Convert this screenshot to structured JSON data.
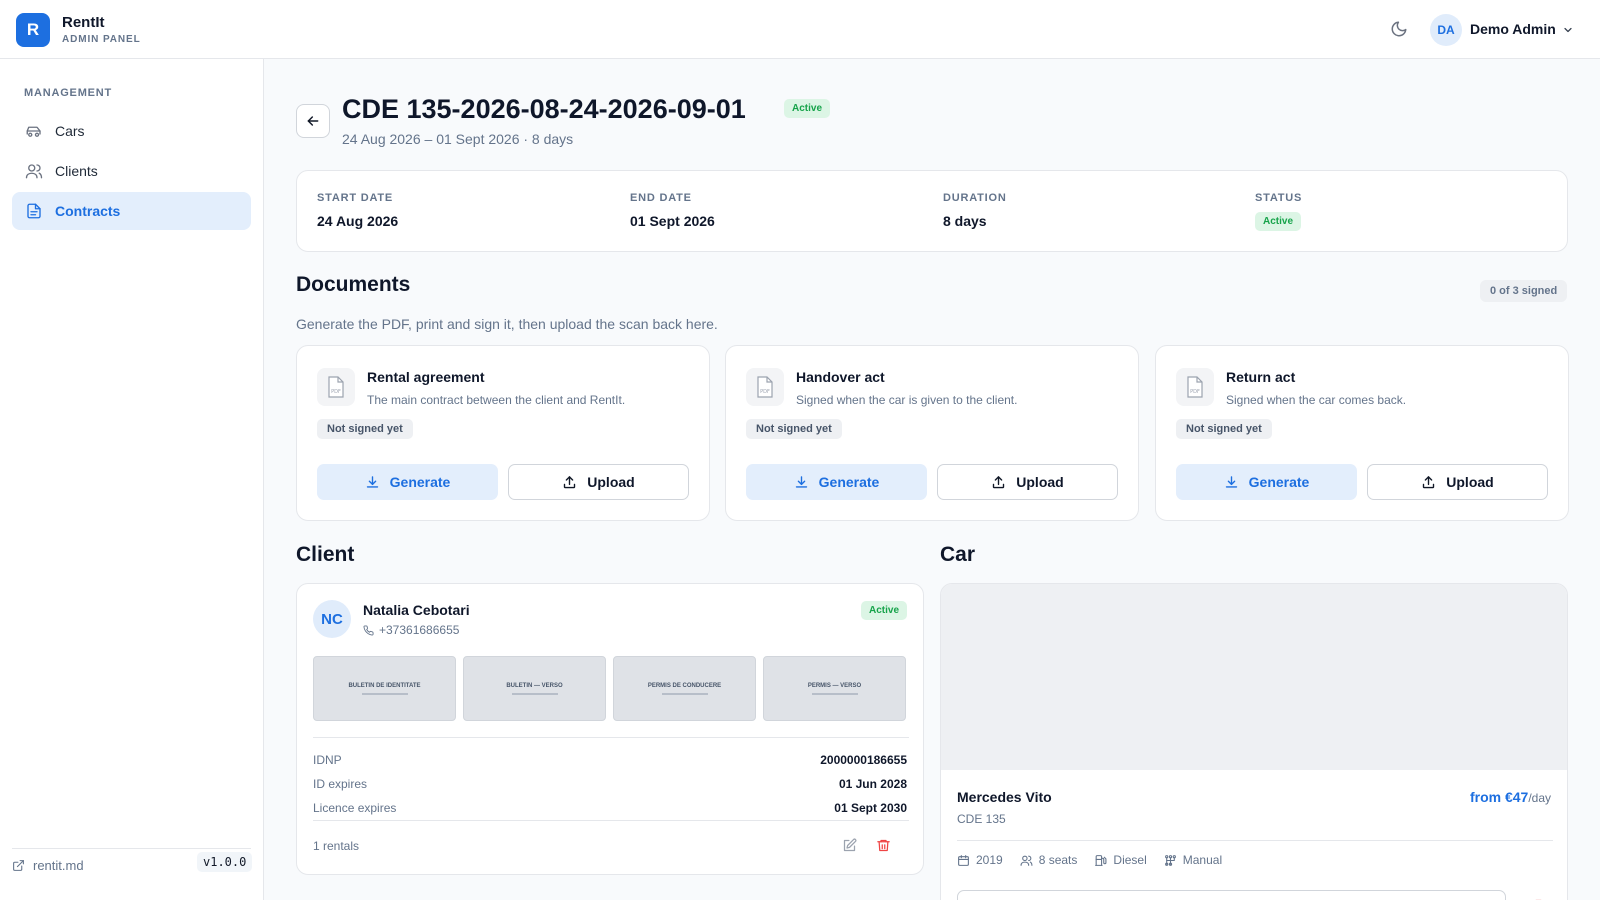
{
  "topbar": {
    "logo_letter": "R",
    "brand_name": "RentIt",
    "brand_sub": "ADMIN PANEL",
    "user_initials": "DA",
    "user_name": "Demo Admin"
  },
  "sidebar": {
    "section_label": "MANAGEMENT",
    "items": [
      {
        "label": "Cars",
        "icon": "car-icon"
      },
      {
        "label": "Clients",
        "icon": "users-icon"
      },
      {
        "label": "Contracts",
        "icon": "document-icon",
        "active": true
      }
    ],
    "footer_link": "rentit.md",
    "version": "v1.0.0"
  },
  "contract": {
    "title": "CDE 135-2026-08-24-2026-09-01",
    "status": "Active",
    "subtitle": "24 Aug 2026 – 01 Sept 2026 · 8 days"
  },
  "summary": {
    "start_label": "START DATE",
    "start_value": "24 Aug 2026",
    "end_label": "END DATE",
    "end_value": "01 Sept 2026",
    "duration_label": "DURATION",
    "duration_value": "8 days",
    "status_label": "STATUS",
    "status_value": "Active"
  },
  "documents": {
    "heading": "Documents",
    "signed_count": "0 of 3 signed",
    "subtitle": "Generate the PDF, print and sign it, then upload the scan back here.",
    "items": [
      {
        "title": "Rental agreement",
        "desc": "The main contract between the client and RentIt.",
        "status": "Not signed yet",
        "generate": "Generate",
        "upload": "Upload"
      },
      {
        "title": "Handover act",
        "desc": "Signed when the car is given to the client.",
        "status": "Not signed yet",
        "generate": "Generate",
        "upload": "Upload"
      },
      {
        "title": "Return act",
        "desc": "Signed when the car comes back.",
        "status": "Not signed yet",
        "generate": "Generate",
        "upload": "Upload"
      }
    ]
  },
  "client": {
    "heading": "Client",
    "initials": "NC",
    "name": "Natalia Cebotari",
    "phone": "+37361686655",
    "status": "Active",
    "thumbs": [
      "BULETIN DE IDENTITATE",
      "BULETIN — VERSO",
      "PERMIS DE CONDUCERE",
      "PERMIS — VERSO"
    ],
    "idnp_label": "IDNP",
    "idnp_value": "2000000186655",
    "id_exp_label": "ID expires",
    "id_exp_value": "01 Jun 2028",
    "lic_exp_label": "Licence expires",
    "lic_exp_value": "01 Sept 2030",
    "rentals": "1 rentals"
  },
  "car": {
    "heading": "Car",
    "name": "Mercedes Vito",
    "plate": "CDE 135",
    "price": "from €47",
    "price_unit": "/day",
    "year": "2019",
    "seats": "8 seats",
    "fuel": "Diesel",
    "transmission": "Manual"
  },
  "colors": {
    "accent": "#1d6fe0",
    "success": "#16a34a",
    "danger": "#ef4444"
  }
}
